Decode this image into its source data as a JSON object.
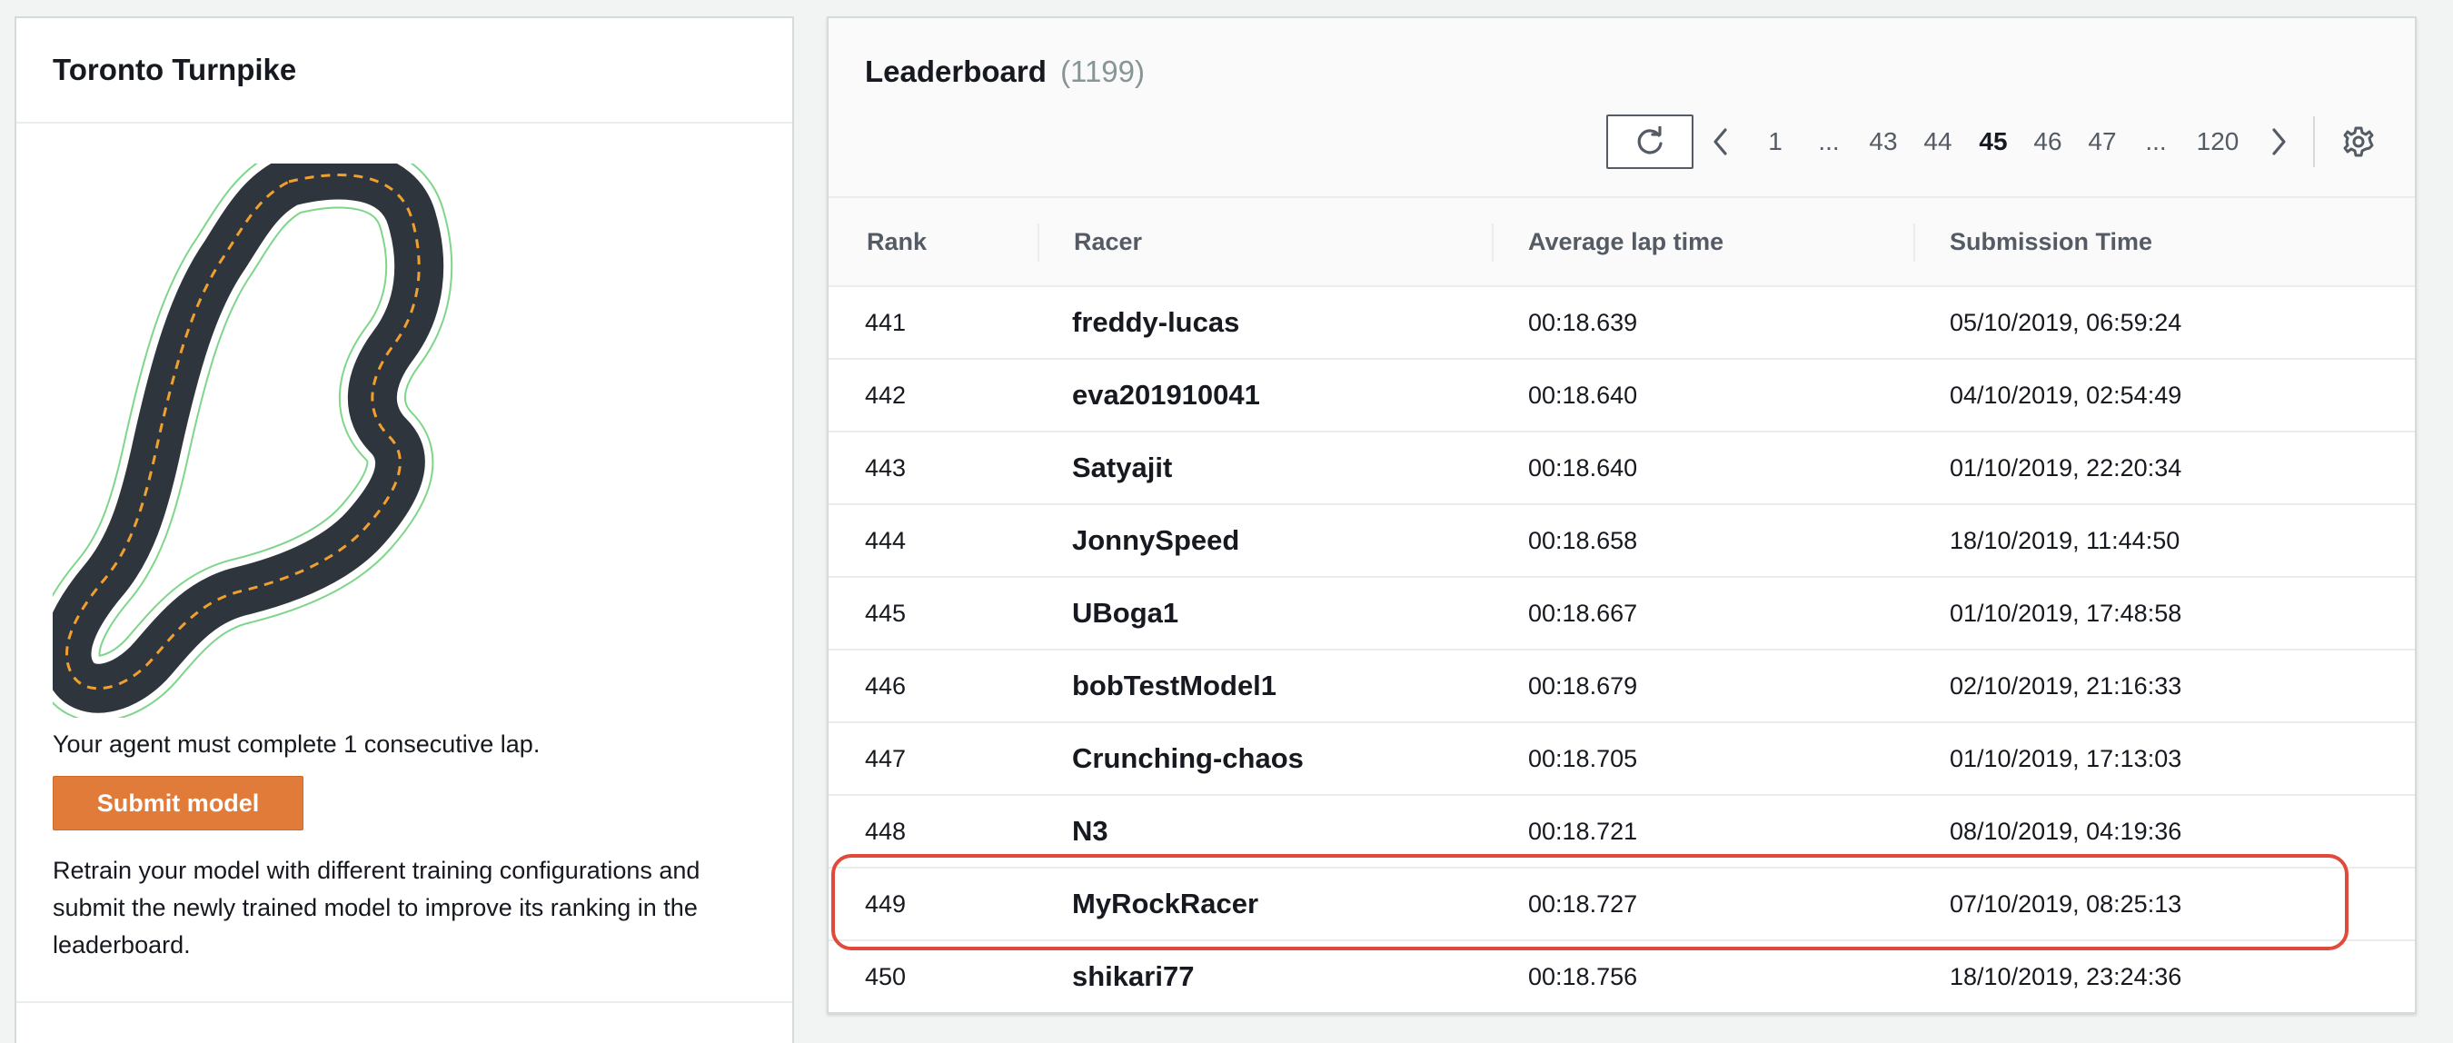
{
  "track": {
    "title": "Toronto Turnpike",
    "requirement": "Your agent must complete 1 consecutive lap.",
    "submit_label": "Submit model",
    "retrain_text": "Retrain your model with different training configurations and submit the newly trained model to improve its ranking in the leaderboard."
  },
  "leaderboard": {
    "title": "Leaderboard",
    "count": "(1199)",
    "refresh_icon": "refresh-icon",
    "settings_icon": "gear-icon",
    "pagination": {
      "prev_icon": "chevron-left-icon",
      "next_icon": "chevron-right-icon",
      "pages": [
        "1",
        "...",
        "43",
        "44",
        "45",
        "46",
        "47",
        "...",
        "120"
      ],
      "current": "45"
    },
    "columns": [
      "Rank",
      "Racer",
      "Average lap time",
      "Submission Time"
    ],
    "rows": [
      {
        "rank": "441",
        "racer": "freddy-lucas",
        "avg_lap": "00:18.639",
        "submitted": "05/10/2019, 06:59:24"
      },
      {
        "rank": "442",
        "racer": "eva201910041",
        "avg_lap": "00:18.640",
        "submitted": "04/10/2019, 02:54:49"
      },
      {
        "rank": "443",
        "racer": "Satyajit",
        "avg_lap": "00:18.640",
        "submitted": "01/10/2019, 22:20:34"
      },
      {
        "rank": "444",
        "racer": "JonnySpeed",
        "avg_lap": "00:18.658",
        "submitted": "18/10/2019, 11:44:50"
      },
      {
        "rank": "445",
        "racer": "UBoga1",
        "avg_lap": "00:18.667",
        "submitted": "01/10/2019, 17:48:58"
      },
      {
        "rank": "446",
        "racer": "bobTestModel1",
        "avg_lap": "00:18.679",
        "submitted": "02/10/2019, 21:16:33"
      },
      {
        "rank": "447",
        "racer": "Crunching-chaos",
        "avg_lap": "00:18.705",
        "submitted": "01/10/2019, 17:13:03"
      },
      {
        "rank": "448",
        "racer": "N3",
        "avg_lap": "00:18.721",
        "submitted": "08/10/2019, 04:19:36"
      },
      {
        "rank": "449",
        "racer": "MyRockRacer",
        "avg_lap": "00:18.727",
        "submitted": "07/10/2019, 08:25:13"
      },
      {
        "rank": "450",
        "racer": "shikari77",
        "avg_lap": "00:18.756",
        "submitted": "18/10/2019, 23:24:36"
      }
    ],
    "highlighted_rank": "449"
  },
  "colors": {
    "accent_orange": "#e07b39",
    "highlight_red": "#e14a3a",
    "track_asphalt": "#2e353c",
    "track_centerline": "#f0a030",
    "track_outline": "#7fd68a"
  }
}
